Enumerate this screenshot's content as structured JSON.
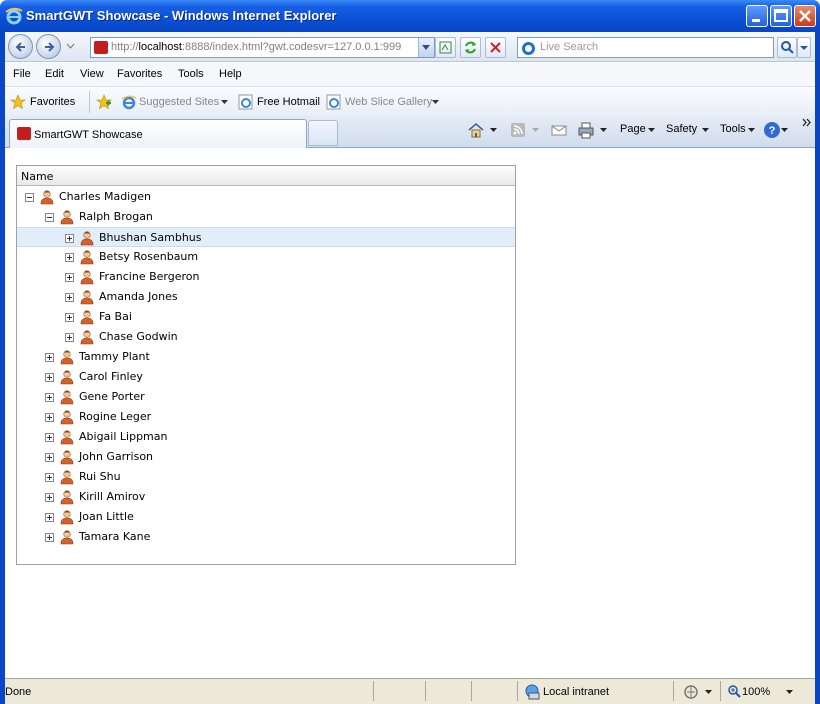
{
  "window": {
    "title": "SmartGWT Showcase - Windows Internet Explorer"
  },
  "address": {
    "url_prefix": "http://",
    "url_host": "localhost",
    "url_rest": ":8888/index.html?gwt.codesvr=127.0.0.1:999"
  },
  "search": {
    "placeholder": "Live Search"
  },
  "menu": {
    "items": [
      "File",
      "Edit",
      "View",
      "Favorites",
      "Tools",
      "Help"
    ]
  },
  "favorites": {
    "label": "Favorites",
    "links": [
      "Suggested Sites",
      "Free Hotmail",
      "Web Slice Gallery"
    ]
  },
  "tabs": [
    {
      "label": "SmartGWT Showcase"
    }
  ],
  "commands": {
    "page": "Page",
    "safety": "Safety",
    "tools": "Tools"
  },
  "tree": {
    "column_header": "Name",
    "selected": "Bhushan Sambhus",
    "rows": [
      {
        "label": "Charles Madigen",
        "level": 0,
        "expanded": true
      },
      {
        "label": "Ralph Brogan",
        "level": 1,
        "expanded": true
      },
      {
        "label": "Bhushan Sambhus",
        "level": 2,
        "expanded": false
      },
      {
        "label": "Betsy Rosenbaum",
        "level": 2,
        "expanded": false
      },
      {
        "label": "Francine Bergeron",
        "level": 2,
        "expanded": false
      },
      {
        "label": "Amanda Jones",
        "level": 2,
        "expanded": false
      },
      {
        "label": "Fa Bai",
        "level": 2,
        "expanded": false
      },
      {
        "label": "Chase Godwin",
        "level": 2,
        "expanded": false
      },
      {
        "label": "Tammy Plant",
        "level": 1,
        "expanded": false
      },
      {
        "label": "Carol Finley",
        "level": 1,
        "expanded": false
      },
      {
        "label": "Gene Porter",
        "level": 1,
        "expanded": false
      },
      {
        "label": "Rogine Leger",
        "level": 1,
        "expanded": false
      },
      {
        "label": "Abigail Lippman",
        "level": 1,
        "expanded": false
      },
      {
        "label": "John Garrison",
        "level": 1,
        "expanded": false
      },
      {
        "label": "Rui Shu",
        "level": 1,
        "expanded": false
      },
      {
        "label": "Kirill Amirov",
        "level": 1,
        "expanded": false
      },
      {
        "label": "Joan Little",
        "level": 1,
        "expanded": false
      },
      {
        "label": "Tamara Kane",
        "level": 1,
        "expanded": false
      }
    ]
  },
  "status": {
    "text": "Done",
    "zone": "Local intranet",
    "zoom": "100%"
  },
  "colors": {
    "titlebar": "#0a50d6",
    "selected_row": "#e1eef9",
    "person_icon": "#d2622a"
  }
}
